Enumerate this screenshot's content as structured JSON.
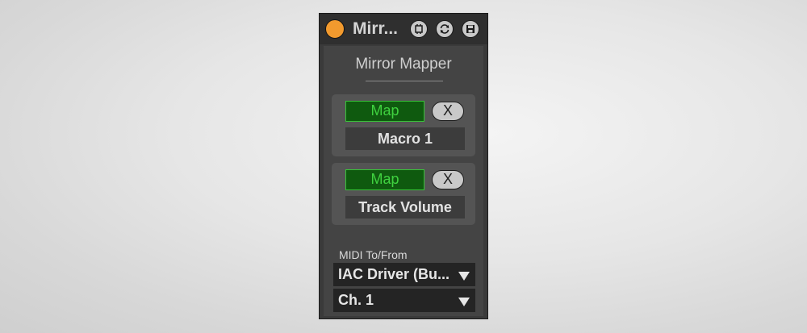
{
  "device": {
    "name": "Mirr...",
    "title": "Mirror Mapper",
    "power_color": "#f29a2e"
  },
  "toolbar": {
    "icons": [
      "fold-icon",
      "hot-swap-icon",
      "save-preset-icon"
    ]
  },
  "mappings": [
    {
      "map_label": "Map",
      "clear_label": "X",
      "target": "Macro 1"
    },
    {
      "map_label": "Map",
      "clear_label": "X",
      "target": "Track Volume"
    }
  ],
  "midi": {
    "label": "MIDI To/From",
    "port": "IAC Driver (Bu...",
    "channel": "Ch. 1"
  },
  "colors": {
    "map_active_fill": "#0f5a0f",
    "map_active_text": "#3fd13f"
  }
}
